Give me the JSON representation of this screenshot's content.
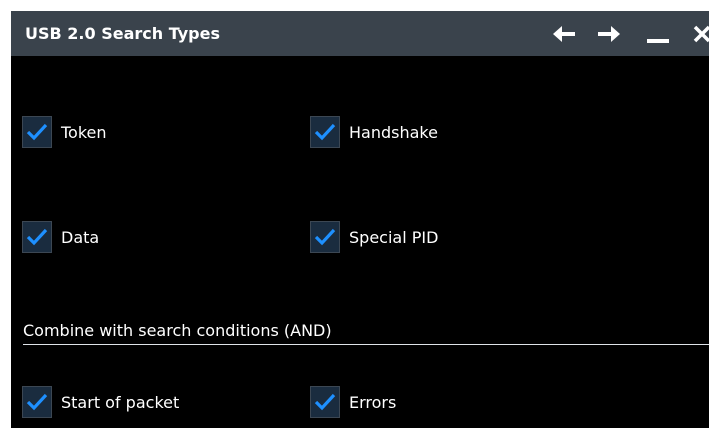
{
  "dialog": {
    "title": "USB 2.0 Search Types",
    "controls": {
      "back": "arrow-left-icon",
      "forward": "arrow-right-icon",
      "minimize": "minimize-icon",
      "close": "close-icon"
    }
  },
  "search_types": [
    {
      "label": "Token",
      "checked": true
    },
    {
      "label": "Handshake",
      "checked": true
    },
    {
      "label": "Data",
      "checked": true
    },
    {
      "label": "Special PID",
      "checked": true
    }
  ],
  "combine": {
    "heading": "Combine with search conditions (AND)",
    "options": [
      {
        "label": "Start of packet",
        "checked": true
      },
      {
        "label": "Errors",
        "checked": true
      }
    ]
  },
  "colors": {
    "titlebar": "#3a434c",
    "background": "#000000",
    "checkbox_fill": "#1a2c3f",
    "checkmark": "#1e90ff",
    "text": "#ffffff"
  }
}
